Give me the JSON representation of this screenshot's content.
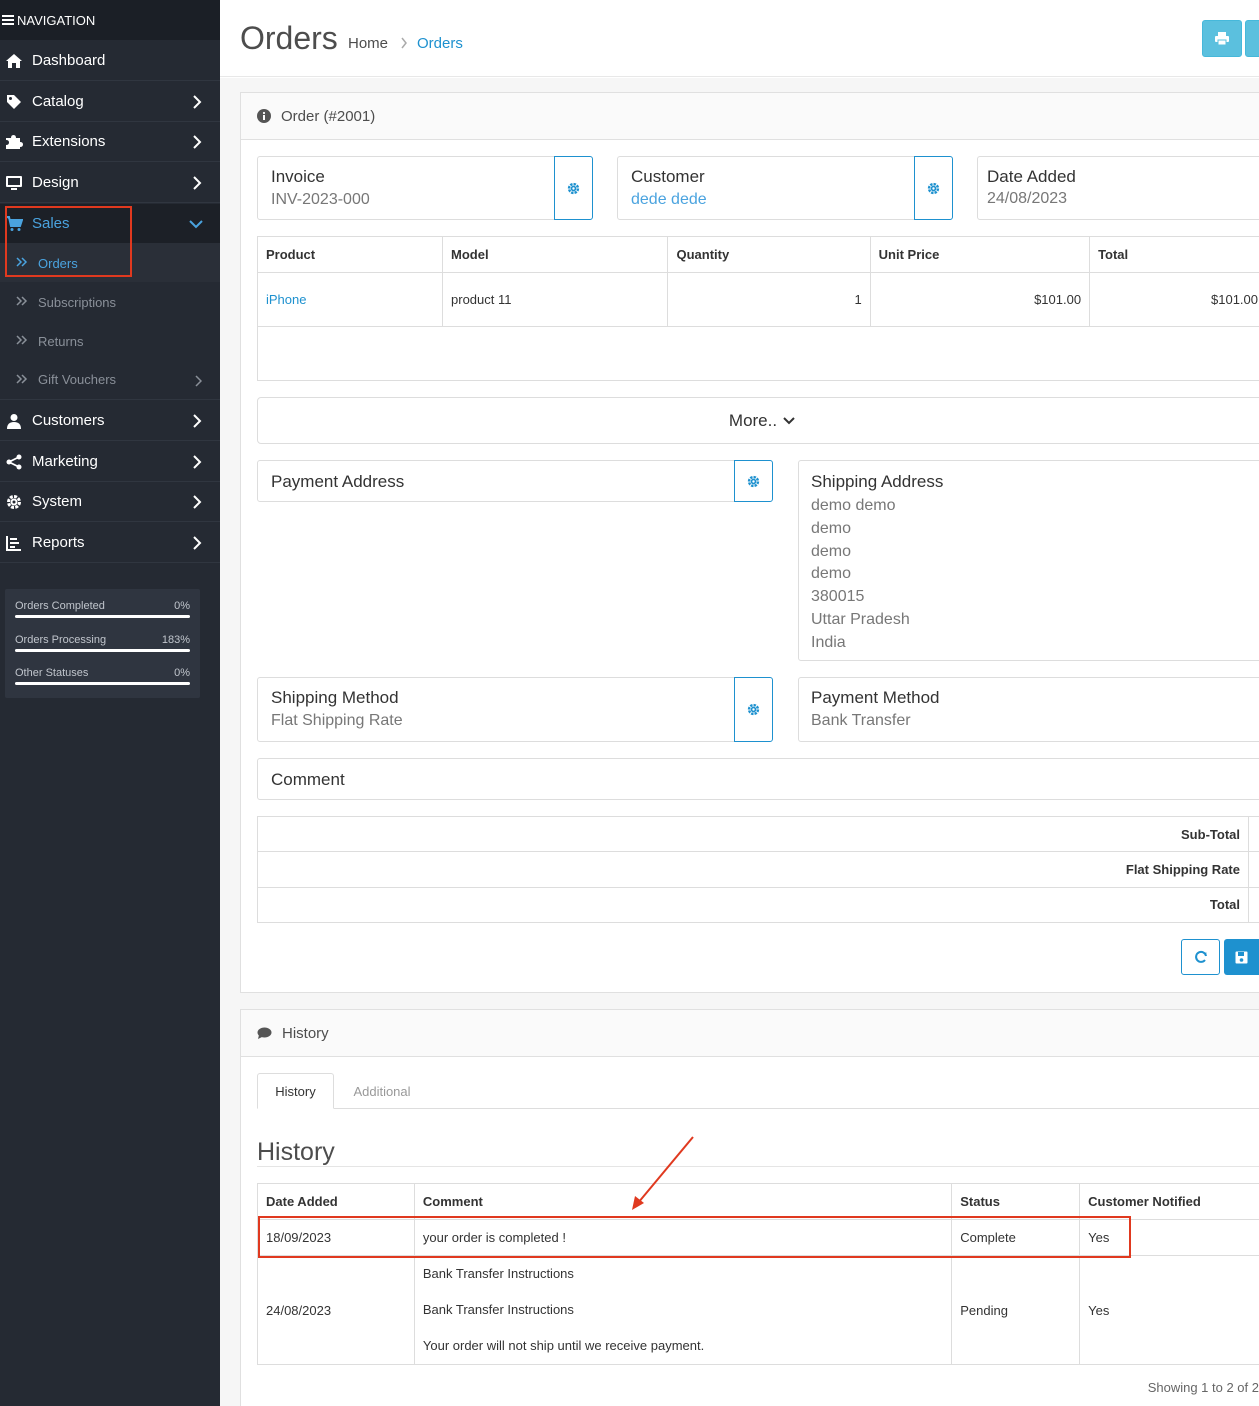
{
  "nav": {
    "header": "NAVIGATION",
    "items": [
      {
        "label": "Dashboard",
        "icon": "home-icon"
      },
      {
        "label": "Catalog",
        "icon": "tag-icon"
      },
      {
        "label": "Extensions",
        "icon": "puzzle-icon"
      },
      {
        "label": "Design",
        "icon": "monitor-icon"
      },
      {
        "label": "Sales",
        "icon": "cart-icon"
      },
      {
        "label": "Customers",
        "icon": "user-icon"
      },
      {
        "label": "Marketing",
        "icon": "share-icon"
      },
      {
        "label": "System",
        "icon": "gear-icon"
      },
      {
        "label": "Reports",
        "icon": "bar-chart-icon"
      }
    ],
    "sales_sub": [
      "Orders",
      "Subscriptions",
      "Returns",
      "Gift Vouchers"
    ],
    "stats": [
      {
        "label": "Orders Completed",
        "value": "0%"
      },
      {
        "label": "Orders Processing",
        "value": "183%"
      },
      {
        "label": "Other Statuses",
        "value": "0%"
      }
    ]
  },
  "header": {
    "title": "Orders",
    "breadcrumb": [
      "Home",
      "Orders"
    ]
  },
  "order": {
    "heading": "Order (#2001)",
    "invoice": {
      "label": "Invoice",
      "value": "INV-2023-000"
    },
    "customer": {
      "label": "Customer",
      "value": "dede dede"
    },
    "date_added": {
      "label": "Date Added",
      "value": "24/08/2023"
    },
    "products": {
      "headers": [
        "Product",
        "Model",
        "Quantity",
        "Unit Price",
        "Total"
      ],
      "rows": [
        {
          "product": "iPhone",
          "model": "product 11",
          "quantity": "1",
          "unit_price": "$101.00",
          "total": "$101.00"
        }
      ]
    },
    "more_label": "More..",
    "payment_address": {
      "label": "Payment Address"
    },
    "shipping_address": {
      "label": "Shipping Address",
      "lines": [
        "demo demo",
        "demo",
        "demo",
        "demo",
        "380015",
        "Uttar Pradesh",
        "India"
      ]
    },
    "shipping_method": {
      "label": "Shipping Method",
      "value": "Flat Shipping Rate"
    },
    "payment_method": {
      "label": "Payment Method",
      "value": "Bank Transfer"
    },
    "comment": {
      "label": "Comment"
    },
    "totals": [
      "Sub-Total",
      "Flat Shipping Rate",
      "Total"
    ]
  },
  "history": {
    "heading": "History",
    "tabs": [
      "History",
      "Additional"
    ],
    "title": "History",
    "headers": [
      "Date Added",
      "Comment",
      "Status",
      "Customer Notified"
    ],
    "rows": [
      {
        "date": "18/09/2023",
        "comment": [
          "your order is completed !"
        ],
        "status": "Complete",
        "notified": "Yes"
      },
      {
        "date": "24/08/2023",
        "comment": [
          "Bank Transfer Instructions",
          "Bank Transfer Instructions",
          "Your order will not ship until we receive payment."
        ],
        "status": "Pending",
        "notified": "Yes"
      }
    ],
    "showing": "Showing 1 to 2 of 2"
  },
  "colors": {
    "sidebar": "#252a33",
    "accent": "#1e91cf",
    "info": "#5bc0de",
    "annotation": "#e0391f"
  }
}
